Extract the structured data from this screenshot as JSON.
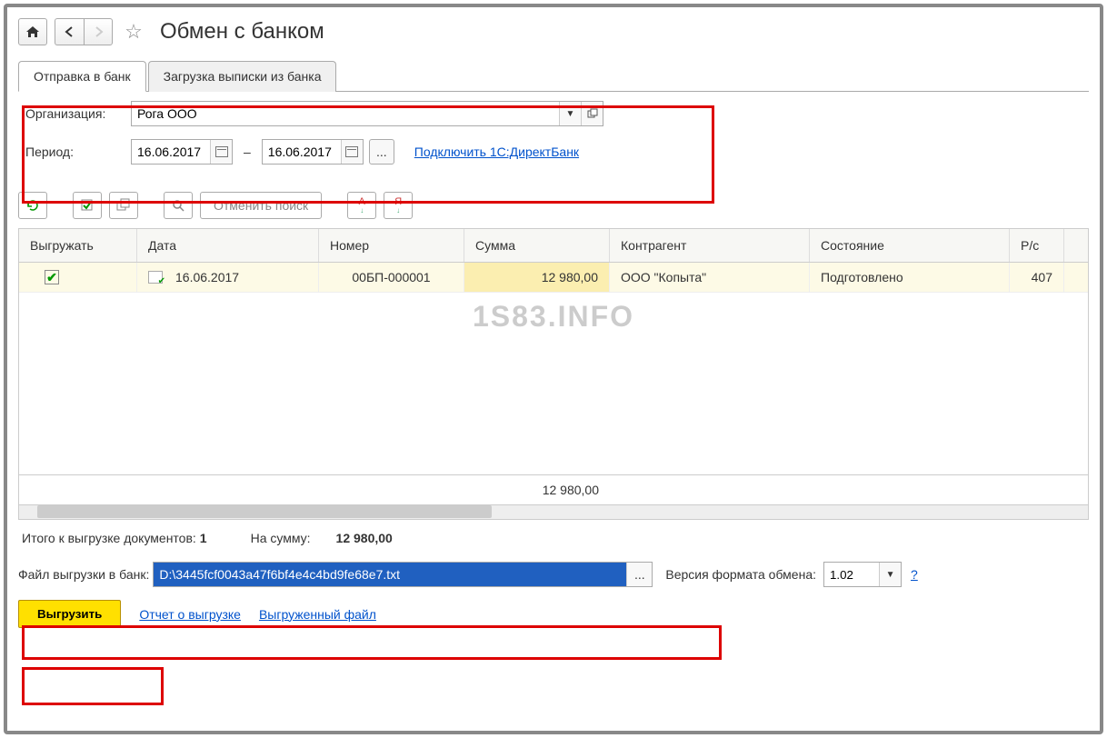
{
  "header": {
    "title": "Обмен с банком"
  },
  "tabs": {
    "send": "Отправка в банк",
    "load": "Загрузка выписки из банка"
  },
  "filters": {
    "org_label": "Организация:",
    "org_value": "Рога ООО",
    "period_label": "Период:",
    "date_from": "16.06.2017",
    "date_to": "16.06.2017",
    "direct_bank_link": "Подключить 1С:ДиректБанк"
  },
  "toolbar": {
    "cancel_search": "Отменить поиск"
  },
  "table": {
    "headers": {
      "export": "Выгружать",
      "date": "Дата",
      "number": "Номер",
      "sum": "Сумма",
      "contragent": "Контрагент",
      "state": "Состояние",
      "account": "Р/с"
    },
    "rows": [
      {
        "date": "16.06.2017",
        "number": "00БП-000001",
        "sum": "12 980,00",
        "contragent": "ООО \"Копыта\"",
        "state": "Подготовлено",
        "account": "407"
      }
    ],
    "footer_sum": "12 980,00"
  },
  "watermark": "1S83.INFO",
  "summary": {
    "docs_label": "Итого к выгрузке документов:",
    "docs_count": "1",
    "sum_label": "На сумму:",
    "sum_value": "12 980,00"
  },
  "file": {
    "label": "Файл выгрузки в банк:",
    "path": "D:\\3445fcf0043a47f6bf4e4c4bd9fe68e7.txt",
    "version_label": "Версия формата обмена:",
    "version_value": "1.02",
    "help": "?"
  },
  "actions": {
    "export": "Выгрузить",
    "report": "Отчет о выгрузке",
    "exported_file": "Выгруженный файл"
  }
}
